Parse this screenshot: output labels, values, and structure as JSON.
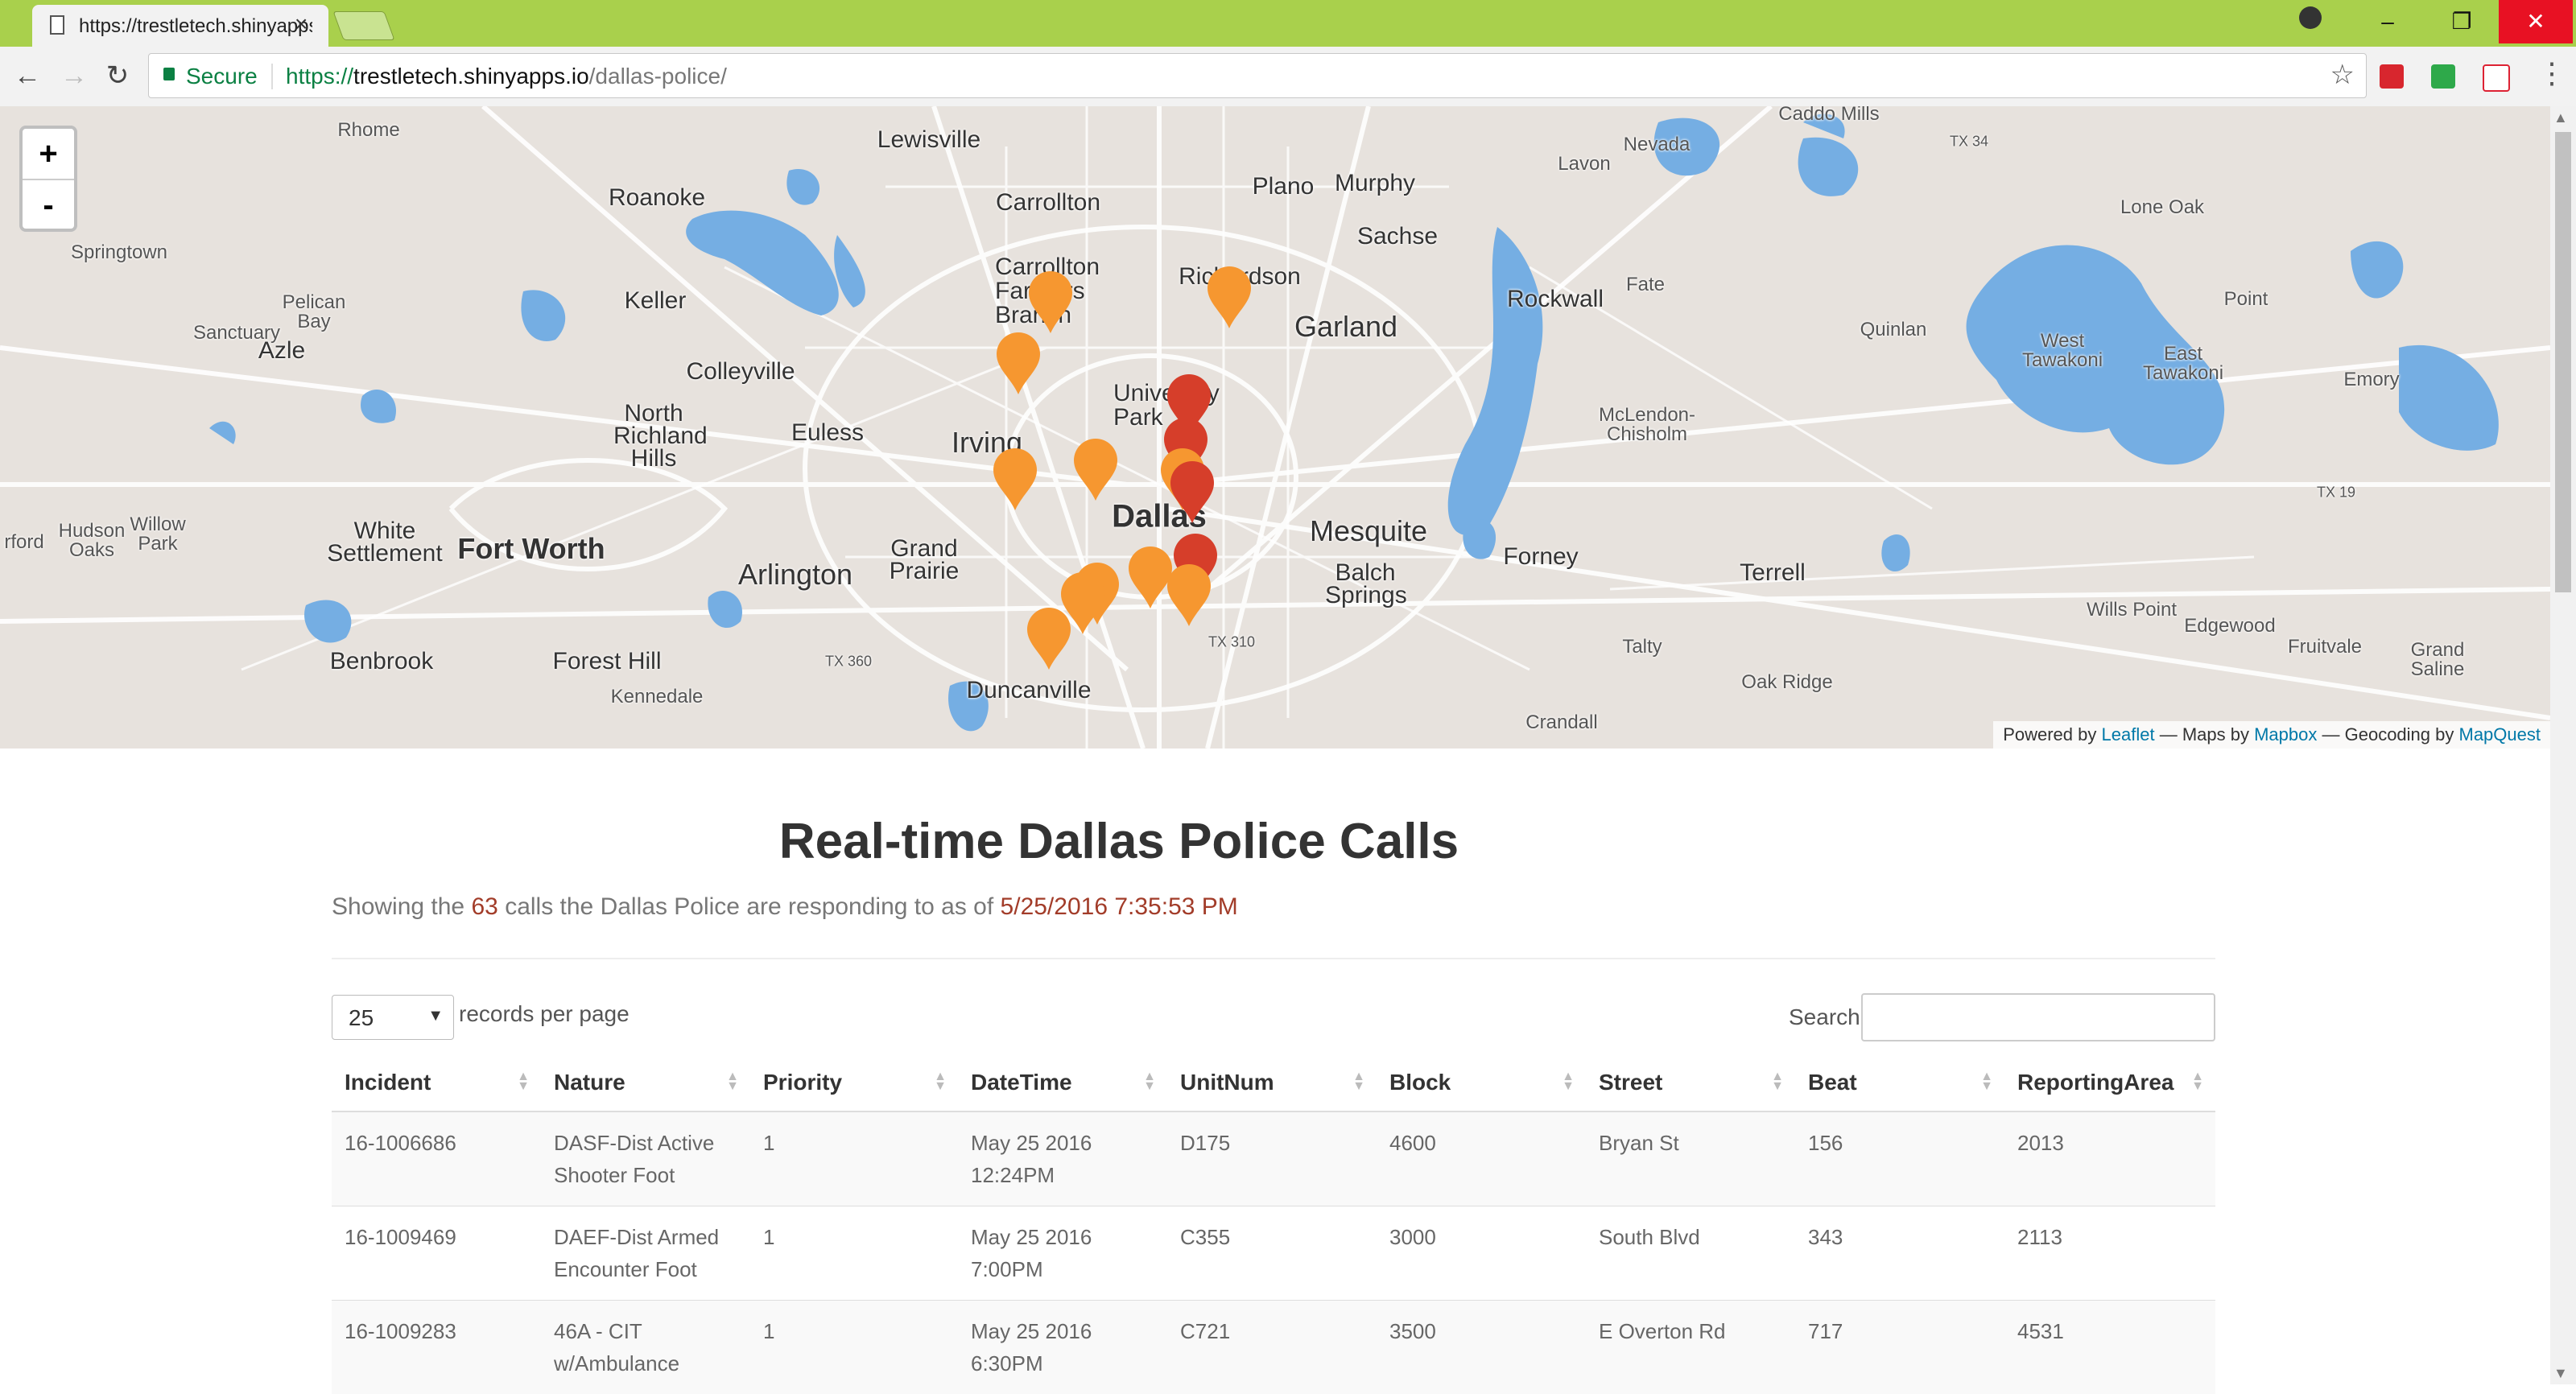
{
  "browser": {
    "tab_title": "https://trestletech.shinyapps.io/dallas-police/",
    "tab_close": "×",
    "secure_label": "Secure",
    "url_scheme": "https://",
    "url_host": "trestletech.shinyapps.io",
    "url_path": "/dallas-police/",
    "back_icon": "←",
    "forward_icon": "→",
    "reload_icon": "↻",
    "star_icon": "☆",
    "menu_icon": "⋮",
    "min_icon": "–",
    "max_icon": "❐",
    "close_icon": "✕"
  },
  "map": {
    "zoom_in": "+",
    "zoom_out": "-",
    "attribution": {
      "powered_by": "Powered by",
      "leaflet": "Leaflet",
      "maps_by": "— Maps by",
      "mapbox": "Mapbox",
      "geocoding_by": "— Geocoding by",
      "mapquest": "MapQuest"
    },
    "places": {
      "rhome": "Rhome",
      "lewisville": "Lewisville",
      "cado_mills": "Caddo Mills",
      "nevada": "Nevada",
      "lavon": "Lavon",
      "tx34": "TX 34",
      "plano": "Plano",
      "murphy": "Murphy",
      "carrollton": "Carrollton",
      "roanoke": "Roanoke",
      "lone_oak": "Lone Oak",
      "springtown": "Springtown",
      "sachse": "Sachse",
      "carrollton_farmers_branch": "Carrollton Farmers Branch",
      "richardson": "Richardson",
      "keller": "Keller",
      "rockwall": "Rockwall",
      "fate": "Fate",
      "pelican_bay": "Pelican Bay",
      "garland": "Garland",
      "point": "Point",
      "sanctuary": "Sanctuary",
      "azle": "Azle",
      "quinlan": "Quinlan",
      "west_tawakoni": "West Tawakoni",
      "east_tawakoni": "East Tawakoni",
      "colleyville": "Colleyville",
      "university_park": "University Park",
      "emory": "Emory",
      "mclendon_chisholm": "McLendon-Chisholm",
      "north_richland_hills": "North Richland Hills",
      "euless": "Euless",
      "irving": "Irving",
      "tx19": "TX 19",
      "hudson_oaks": "Hudson Oaks",
      "willow_park": "Willow Park",
      "white_settlement": "White Settlement",
      "fort_worth": "Fort Worth",
      "dallas": "Dallas",
      "mesquite": "Mesquite",
      "forney": "Forney",
      "grand_prairie": "Grand Prairie",
      "arlington": "Arlington",
      "terrell": "Terrell",
      "balch_springs": "Balch Springs",
      "wills_point": "Wills Point",
      "edgewood": "Edgewood",
      "tx310": "TX 310",
      "fruitvale": "Fruitvale",
      "grand_saline": "Grand Saline",
      "benbrook": "Benbrook",
      "forest_hill": "Forest Hill",
      "tx360": "TX 360",
      "talty": "Talty",
      "duncanville": "Duncanville",
      "oak_ridge": "Oak Ridge",
      "kennedale": "Kennedale",
      "crandall": "Crandall",
      "rford": "rford"
    },
    "marker_colors": {
      "orange": "#f69730",
      "red": "#d63e2a"
    }
  },
  "page": {
    "title": "Real-time Dallas Police Calls",
    "subtitle_pre": "Showing the",
    "call_count": "63",
    "subtitle_mid": "calls the Dallas Police are responding to as of",
    "timestamp": "5/25/2016 7:35:53 PM",
    "page_length": "25",
    "records_per_page": "records per page",
    "search_label": "Search:"
  },
  "table": {
    "columns": [
      "Incident",
      "Nature",
      "Priority",
      "DateTime",
      "UnitNum",
      "Block",
      "Street",
      "Beat",
      "ReportingArea"
    ],
    "rows": [
      [
        "16-1006686",
        "DASF-Dist Active Shooter Foot",
        "1",
        "May 25 2016 12:24PM",
        "D175",
        "4600",
        "Bryan St",
        "156",
        "2013"
      ],
      [
        "16-1009469",
        "DAEF-Dist Armed Encounter Foot",
        "1",
        "May 25 2016 7:00PM",
        "C355",
        "3000",
        "South Blvd",
        "343",
        "2113"
      ],
      [
        "16-1009283",
        "46A - CIT w/Ambulance",
        "1",
        "May 25 2016 6:30PM",
        "C721",
        "3500",
        "E Overton Rd",
        "717",
        "4531"
      ]
    ]
  }
}
